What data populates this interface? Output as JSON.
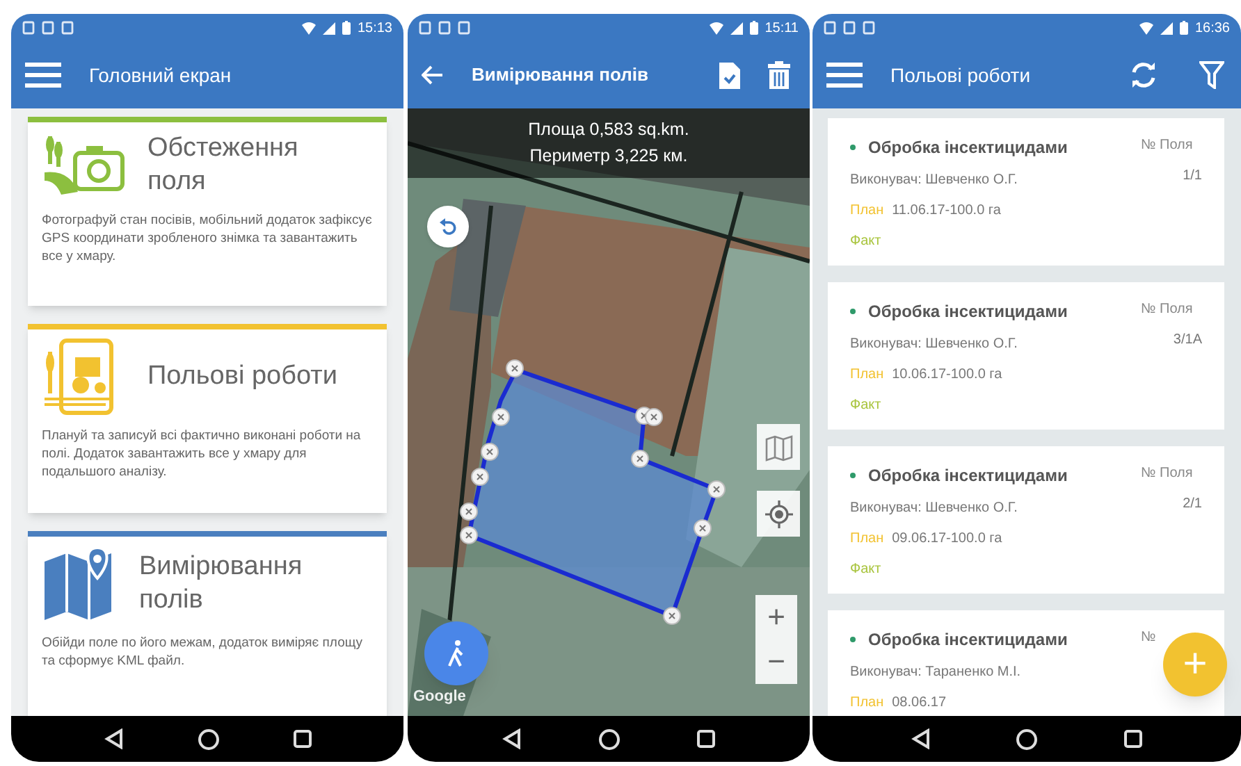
{
  "screens": [
    {
      "kind": "home",
      "status_time": "15:13",
      "title": "Головний екран",
      "cards": [
        {
          "kind": "survey",
          "color": "#8cbf3f",
          "title": "Обстеження поля",
          "text": "Фотографуй стан посівів, мобільний додаток зафіксує GPS координати зробленого знімка та завантажить все у хмару."
        },
        {
          "kind": "works",
          "color": "#f2c230",
          "title": "Польові роботи",
          "text": "Плануй та записуй всі фактично виконані роботи на полі. Додаток завантажить все у хмару для подальшого аналізу."
        },
        {
          "kind": "measure",
          "color": "#4a7fbf",
          "title": "Вимірювання полів",
          "text": "Обійди поле по його межам, додаток виміряє площу та сформує KML файл."
        }
      ]
    },
    {
      "kind": "map",
      "status_time": "15:11",
      "title": "Вимірювання полів",
      "area": "Площа 0,583 sq.km.",
      "perimeter": "Периметр 3,225 км.",
      "map_logo": "Google",
      "zoom_in": "+",
      "zoom_out": "−"
    },
    {
      "kind": "list",
      "status_time": "16:36",
      "title": "Польові роботи",
      "fab": "+",
      "items": [
        {
          "title": "Обробка інсектицидами",
          "executor": "Виконувач: Шевченко О.Г.",
          "plan_label": "План",
          "plan": "11.06.17-100.0 га",
          "fact_label": "Факт",
          "field_label": "№ Поля",
          "field": "1/1"
        },
        {
          "title": "Обробка інсектицидами",
          "executor": "Виконувач: Шевченко О.Г.",
          "plan_label": "План",
          "plan": "10.06.17-100.0 га",
          "fact_label": "Факт",
          "field_label": "№ Поля",
          "field": "3/1А"
        },
        {
          "title": "Обробка інсектицидами",
          "executor": "Виконувач: Шевченко О.Г.",
          "plan_label": "План",
          "plan": "09.06.17-100.0 га",
          "fact_label": "Факт",
          "field_label": "№ Поля",
          "field": "2/1"
        },
        {
          "title": "Обробка інсектицидами",
          "executor": "Виконувач: Тараненко М.І.",
          "plan_label": "План",
          "plan": "08.06.17",
          "field_label": "№"
        }
      ]
    }
  ]
}
